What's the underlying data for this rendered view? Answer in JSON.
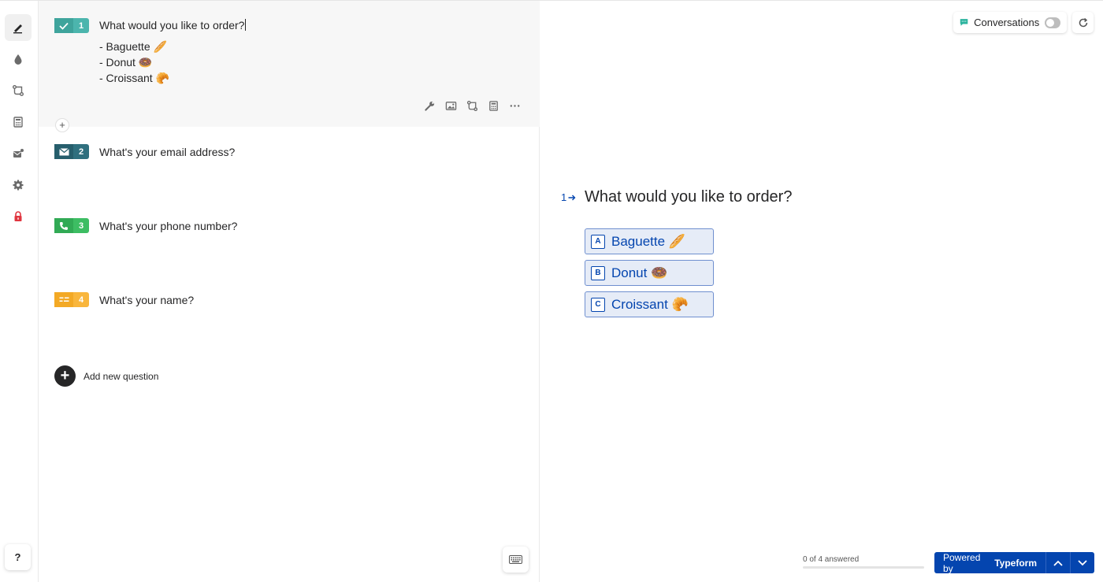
{
  "sidebar": {
    "icons": [
      "create-icon",
      "design-icon",
      "logic-icon",
      "calculator-icon",
      "connect-icon",
      "settings-icon",
      "lock-icon"
    ],
    "help_label": "?"
  },
  "editor": {
    "questions": [
      {
        "number": "1",
        "type_icon": "checkmark-icon",
        "title": "What would you like to order?",
        "options": [
          "- Baguette 🥖",
          "- Donut 🍩",
          "- Croissant 🥐"
        ],
        "color": "#4cb5ad"
      },
      {
        "number": "2",
        "type_icon": "mail-icon",
        "title": "What's your email address?",
        "color": "#2f6f7e"
      },
      {
        "number": "3",
        "type_icon": "phone-icon",
        "title": "What's your phone number?",
        "color": "#3dbd63"
      },
      {
        "number": "4",
        "type_icon": "name-icon",
        "title": "What's your name?",
        "color": "#f9b63c"
      }
    ],
    "toolbar_icons": [
      "wrench-icon",
      "image-icon",
      "logic-jump-icon",
      "calculator-icon",
      "more-icon"
    ],
    "mini_add": "+",
    "add_question_label": "Add new question",
    "add_question_icon": "+"
  },
  "preview": {
    "conversations_label": "Conversations",
    "conversations_enabled": false,
    "question_number": "1",
    "question_title": "What would you like to order?",
    "choices": [
      {
        "key": "A",
        "label": "Baguette 🥖"
      },
      {
        "key": "B",
        "label": "Donut 🍩"
      },
      {
        "key": "C",
        "label": "Croissant 🥐"
      }
    ],
    "accent_color": "#0445af",
    "progress_label": "0 of 4 answered",
    "progress_fraction": 0,
    "powered_by": "Powered by",
    "brand": "Typeform"
  }
}
